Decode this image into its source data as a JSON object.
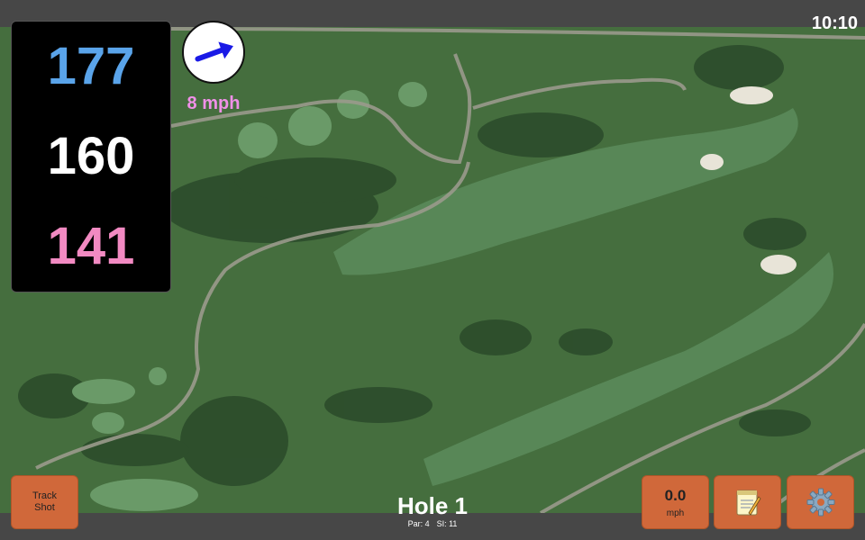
{
  "status": {
    "time": "10:10"
  },
  "yardages": {
    "back": "177",
    "middle": "160",
    "front": "141"
  },
  "wind": {
    "speed": "8 mph",
    "icon": "wind-arrow-icon"
  },
  "hole": {
    "title": "Hole 1",
    "par": "Par: 4",
    "si": "SI: 11"
  },
  "buttons": {
    "track_shot": {
      "line1": "Track",
      "line2": "Shot"
    },
    "speed": {
      "value": "0.0",
      "unit": "mph"
    },
    "notes": {
      "icon": "notepad-icon"
    },
    "settings": {
      "icon": "gear-icon"
    }
  },
  "colors": {
    "back": "#5aa4ea",
    "middle": "#ffffff",
    "front": "#f28ac2",
    "wind_text": "#f090e8",
    "button": "#d0683a"
  }
}
